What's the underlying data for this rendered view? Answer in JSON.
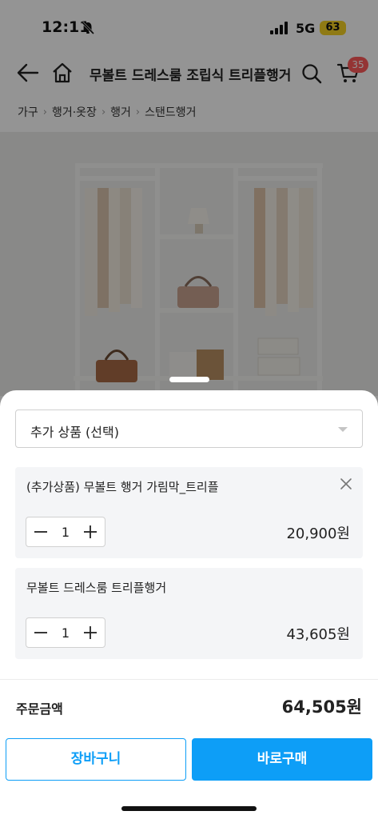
{
  "status_bar": {
    "time": "12:11",
    "network": "5G",
    "battery": "63"
  },
  "header": {
    "title": "무볼트 드레스룸 조립식 트리플행거",
    "cart_count": "35"
  },
  "breadcrumb": [
    "가구",
    "행거·옷장",
    "행거",
    "스탠드행거"
  ],
  "sheet": {
    "option_select": {
      "label": "추가 상품 (선택)"
    },
    "items": [
      {
        "name": "(추가상품) 무볼트 행거 가림막_트리플",
        "quantity": "1",
        "price": "20,900원",
        "removable": true
      },
      {
        "name": "무볼트 드레스룸 트리플행거",
        "quantity": "1",
        "price": "43,605원",
        "removable": false
      }
    ],
    "total_label": "주문금액",
    "total_value": "64,505원",
    "cart_button": "장바구니",
    "buy_button": "바로구매"
  },
  "colors": {
    "accent": "#0d9ef7",
    "badge": "#ff5a5a",
    "battery": "#f6d323"
  },
  "icons": [
    "bell-slash-icon",
    "signal-icon",
    "back-arrow-icon",
    "home-icon",
    "search-icon",
    "cart-icon",
    "chevron-right-icon",
    "caret-down-icon",
    "close-icon",
    "minus-icon",
    "plus-icon"
  ]
}
